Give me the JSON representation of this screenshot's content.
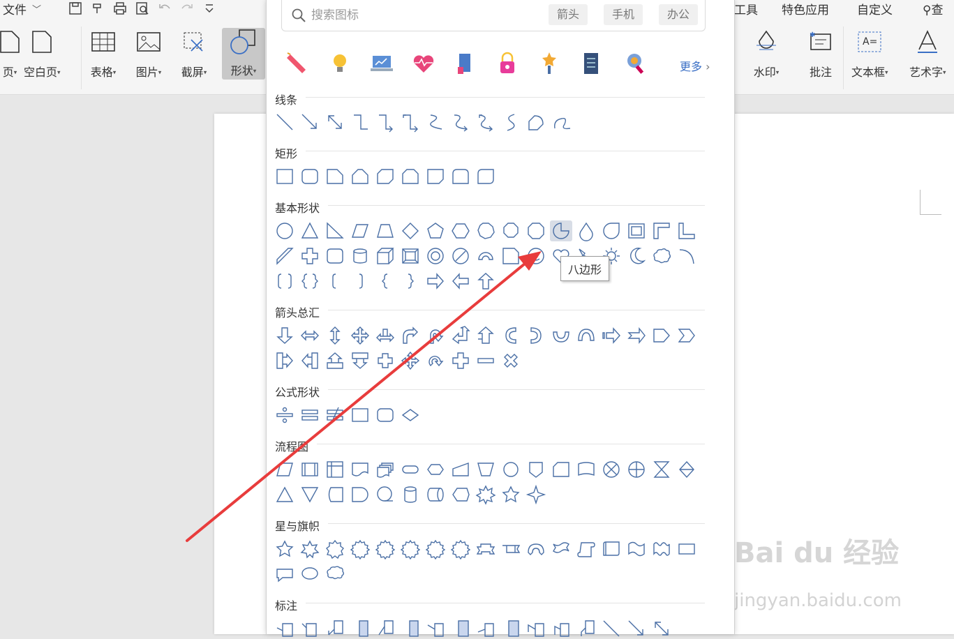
{
  "qat": {
    "file": "文件"
  },
  "tabs": {
    "tools": "工具",
    "special": "特色应用",
    "custom": "自定义",
    "search": "查"
  },
  "ribbon": {
    "left_cut": "页",
    "blank": "空白页",
    "table": "表格",
    "picture": "图片",
    "screenshot": "截屏",
    "shapes": "形状",
    "watermark": "水印",
    "comment": "批注",
    "textbox": "文本框",
    "wordart": "艺术字"
  },
  "search": {
    "placeholder": "搜索图标",
    "tags": [
      "箭头",
      "手机",
      "办公"
    ]
  },
  "icons": {
    "more": "更多"
  },
  "sections": {
    "lines": "线条",
    "rect": "矩形",
    "basic": "基本形状",
    "arrows": "箭头总汇",
    "formula": "公式形状",
    "flowchart": "流程图",
    "stars": "星与旗帜",
    "callouts": "标注"
  },
  "tooltip": "八边形",
  "watermark": {
    "brand": "Bai du 经验",
    "url": "jingyan.baidu.com"
  },
  "colors": {
    "shape_stroke": "#4a6fa5",
    "accent": "#3a6fc5",
    "annotation": "#e83c3c",
    "highlight": "#d8dde6"
  }
}
